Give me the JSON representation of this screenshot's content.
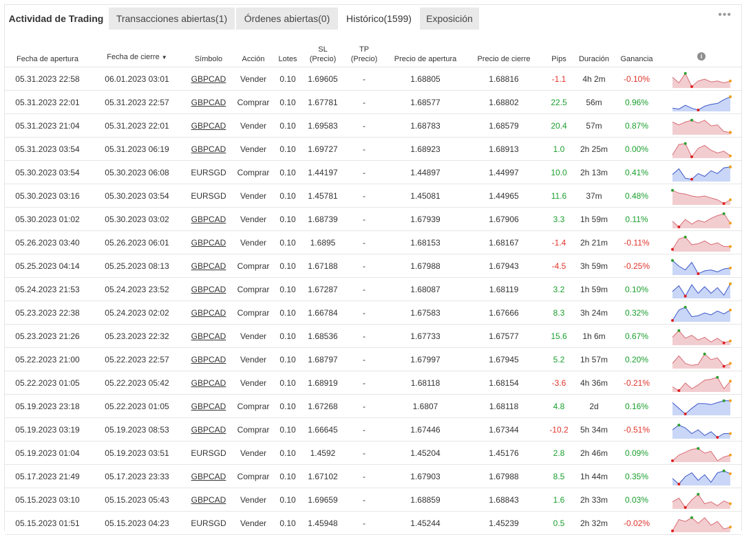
{
  "tabs": {
    "title": "Actividad de Trading",
    "open_transactions": "Transacciones abiertas(1)",
    "open_orders": "Órdenes abiertas(0)",
    "history": "Histórico(1599)",
    "exposure": "Exposición",
    "more": "•••"
  },
  "columns": {
    "open_date": "Fecha de apertura",
    "close_date": "Fecha de cierre",
    "sort_arrow": "▼",
    "symbol": "Símbolo",
    "action": "Acción",
    "lots": "Lotes",
    "sl_1": "SL",
    "sl_2": "(Precio)",
    "tp_1": "TP",
    "tp_2": "(Precio)",
    "open_price": "Precio de apertura",
    "close_price": "Precio de cierre",
    "pips": "Pips",
    "duration": "Duración",
    "profit": "Ganancia",
    "info": "i"
  },
  "colors": {
    "positive": "#1a9e2d",
    "negative": "#e0342b",
    "sell_fill": "#f2cdd0",
    "sell_line": "#d86b73",
    "buy_fill": "#c9d6f7",
    "buy_line": "#3b56c9"
  },
  "rows": [
    {
      "open": "05.31.2023 22:58",
      "close": "06.01.2023 03:01",
      "symbol": "GBPCAD",
      "link": true,
      "action": "Vender",
      "lots": "0.10",
      "sl": "1.69605",
      "tp": "-",
      "open_price": "1.68805",
      "close_price": "1.68816",
      "pips": "-1.1",
      "duration": "4h 2m",
      "profit": "-0.10%",
      "spark": [
        6,
        12,
        2,
        16,
        10,
        8,
        11,
        10,
        12,
        10
      ]
    },
    {
      "open": "05.31.2023 22:01",
      "close": "05.31.2023 22:57",
      "symbol": "GBPCAD",
      "link": true,
      "action": "Comprar",
      "lots": "0.10",
      "sl": "1.67781",
      "tp": "-",
      "open_price": "1.68577",
      "close_price": "1.68802",
      "pips": "22.5",
      "duration": "56m",
      "profit": "0.96%",
      "spark": [
        14,
        15,
        11,
        14,
        16,
        12,
        10,
        9,
        5,
        2
      ]
    },
    {
      "open": "05.31.2023 21:04",
      "close": "05.31.2023 22:01",
      "symbol": "GBPCAD",
      "link": true,
      "action": "Vender",
      "lots": "0.10",
      "sl": "1.69583",
      "tp": "-",
      "open_price": "1.68783",
      "close_price": "1.68579",
      "pips": "20.4",
      "duration": "57m",
      "profit": "0.87%",
      "spark": [
        4,
        7,
        4,
        2,
        5,
        2,
        8,
        7,
        14,
        15
      ]
    },
    {
      "open": "05.31.2023 03:54",
      "close": "05.31.2023 06:19",
      "symbol": "GBPCAD",
      "link": true,
      "action": "Vender",
      "lots": "0.10",
      "sl": "1.69727",
      "tp": "-",
      "open_price": "1.68923",
      "close_price": "1.68913",
      "pips": "1.0",
      "duration": "2h 25m",
      "profit": "0.00%",
      "spark": [
        14,
        3,
        2,
        16,
        7,
        4,
        9,
        12,
        10,
        15
      ]
    },
    {
      "open": "05.30.2023 03:54",
      "close": "05.30.2023 06:08",
      "symbol": "EURSGD",
      "link": false,
      "action": "Comprar",
      "lots": "0.10",
      "sl": "1.44197",
      "tp": "-",
      "open_price": "1.44897",
      "close_price": "1.44997",
      "pips": "10.0",
      "duration": "2h 13m",
      "profit": "0.41%",
      "spark": [
        10,
        4,
        14,
        15,
        9,
        12,
        6,
        9,
        3,
        2
      ]
    },
    {
      "open": "05.30.2023 03:16",
      "close": "05.30.2023 03:54",
      "symbol": "EURSGD",
      "link": false,
      "action": "Vender",
      "lots": "0.10",
      "sl": "1.45781",
      "tp": "-",
      "open_price": "1.45081",
      "close_price": "1.44965",
      "pips": "11.6",
      "duration": "37m",
      "profit": "0.48%",
      "spark": [
        2,
        5,
        6,
        8,
        9,
        8,
        10,
        12,
        16,
        12
      ]
    },
    {
      "open": "05.30.2023 01:02",
      "close": "05.30.2023 03:02",
      "symbol": "GBPCAD",
      "link": true,
      "action": "Vender",
      "lots": "0.10",
      "sl": "1.68739",
      "tp": "-",
      "open_price": "1.67939",
      "close_price": "1.67906",
      "pips": "3.3",
      "duration": "1h 59m",
      "profit": "0.11%",
      "spark": [
        10,
        16,
        8,
        13,
        9,
        11,
        7,
        4,
        2,
        12
      ]
    },
    {
      "open": "05.26.2023 03:40",
      "close": "05.26.2023 06:01",
      "symbol": "GBPCAD",
      "link": true,
      "action": "Vender",
      "lots": "0.10",
      "sl": "1.6895",
      "tp": "-",
      "open_price": "1.68153",
      "close_price": "1.68167",
      "pips": "-1.4",
      "duration": "2h 21m",
      "profit": "-0.11%",
      "spark": [
        15,
        4,
        2,
        10,
        9,
        6,
        10,
        8,
        12,
        12
      ]
    },
    {
      "open": "05.25.2023 04:14",
      "close": "05.25.2023 08:13",
      "symbol": "GBPCAD",
      "link": true,
      "action": "Comprar",
      "lots": "0.10",
      "sl": "1.67188",
      "tp": "-",
      "open_price": "1.67988",
      "close_price": "1.67943",
      "pips": "-4.5",
      "duration": "3h 59m",
      "profit": "-0.25%",
      "spark": [
        2,
        8,
        12,
        4,
        16,
        13,
        12,
        14,
        11,
        10
      ]
    },
    {
      "open": "05.24.2023 21:53",
      "close": "05.24.2023 23:52",
      "symbol": "GBPCAD",
      "link": true,
      "action": "Comprar",
      "lots": "0.10",
      "sl": "1.67287",
      "tp": "-",
      "open_price": "1.68087",
      "close_price": "1.68119",
      "pips": "3.2",
      "duration": "1h 59m",
      "profit": "0.10%",
      "spark": [
        10,
        4,
        15,
        3,
        12,
        5,
        12,
        6,
        14,
        2
      ]
    },
    {
      "open": "05.23.2023 22:38",
      "close": "05.24.2023 02:02",
      "symbol": "GBPCAD",
      "link": true,
      "action": "Comprar",
      "lots": "0.10",
      "sl": "1.66784",
      "tp": "-",
      "open_price": "1.67583",
      "close_price": "1.67666",
      "pips": "8.3",
      "duration": "3h 24m",
      "profit": "0.32%",
      "spark": [
        16,
        5,
        2,
        12,
        11,
        8,
        10,
        6,
        9,
        5
      ]
    },
    {
      "open": "05.23.2023 21:26",
      "close": "05.23.2023 22:32",
      "symbol": "GBPCAD",
      "link": true,
      "action": "Vender",
      "lots": "0.10",
      "sl": "1.68536",
      "tp": "-",
      "open_price": "1.67733",
      "close_price": "1.67577",
      "pips": "15.6",
      "duration": "1h 6m",
      "profit": "0.67%",
      "spark": [
        9,
        2,
        10,
        7,
        12,
        9,
        14,
        10,
        15,
        13
      ]
    },
    {
      "open": "05.22.2023 21:00",
      "close": "05.22.2023 22:57",
      "symbol": "GBPCAD",
      "link": true,
      "action": "Vender",
      "lots": "0.10",
      "sl": "1.68797",
      "tp": "-",
      "open_price": "1.67997",
      "close_price": "1.67945",
      "pips": "5.2",
      "duration": "1h 57m",
      "profit": "0.20%",
      "spark": [
        12,
        4,
        12,
        14,
        13,
        2,
        8,
        6,
        15,
        12
      ]
    },
    {
      "open": "05.22.2023 01:05",
      "close": "05.22.2023 05:42",
      "symbol": "GBPCAD",
      "link": true,
      "action": "Vender",
      "lots": "0.10",
      "sl": "1.68919",
      "tp": "-",
      "open_price": "1.68118",
      "close_price": "1.68154",
      "pips": "-3.6",
      "duration": "4h 36m",
      "profit": "-0.21%",
      "spark": [
        12,
        16,
        8,
        14,
        10,
        5,
        4,
        2,
        14,
        6
      ]
    },
    {
      "open": "05.19.2023 23:18",
      "close": "05.22.2023 01:05",
      "symbol": "GBPCAD",
      "link": true,
      "action": "Comprar",
      "lots": "0.10",
      "sl": "1.67268",
      "tp": "-",
      "open_price": "1.6807",
      "close_price": "1.68118",
      "pips": "4.8",
      "duration": "2d",
      "profit": "0.16%",
      "spark": [
        4,
        10,
        16,
        10,
        5,
        5,
        6,
        4,
        2,
        2
      ]
    },
    {
      "open": "05.19.2023 03:19",
      "close": "05.19.2023 08:53",
      "symbol": "GBPCAD",
      "link": true,
      "action": "Comprar",
      "lots": "0.10",
      "sl": "1.66645",
      "tp": "-",
      "open_price": "1.67446",
      "close_price": "1.67344",
      "pips": "-10.2",
      "duration": "5h 34m",
      "profit": "-0.51%",
      "spark": [
        8,
        3,
        6,
        12,
        8,
        14,
        10,
        16,
        12,
        12
      ]
    },
    {
      "open": "05.19.2023 01:04",
      "close": "05.19.2023 03:51",
      "symbol": "EURSGD",
      "link": false,
      "action": "Vender",
      "lots": "0.10",
      "sl": "1.4592",
      "tp": "-",
      "open_price": "1.45204",
      "close_price": "1.45176",
      "pips": "2.8",
      "duration": "2h 46m",
      "profit": "0.09%",
      "spark": [
        16,
        10,
        7,
        4,
        3,
        8,
        6,
        16,
        12,
        10
      ]
    },
    {
      "open": "05.17.2023 21:49",
      "close": "05.17.2023 23:33",
      "symbol": "GBPCAD",
      "link": true,
      "action": "Comprar",
      "lots": "0.10",
      "sl": "1.67102",
      "tp": "-",
      "open_price": "1.67903",
      "close_price": "1.67988",
      "pips": "8.5",
      "duration": "1h 44m",
      "profit": "0.35%",
      "spark": [
        10,
        16,
        8,
        4,
        12,
        6,
        14,
        4,
        2,
        5
      ]
    },
    {
      "open": "05.15.2023 03:10",
      "close": "05.15.2023 05:43",
      "symbol": "GBPCAD",
      "link": true,
      "action": "Vender",
      "lots": "0.10",
      "sl": "1.69659",
      "tp": "-",
      "open_price": "1.68859",
      "close_price": "1.68843",
      "pips": "1.6",
      "duration": "2h 33m",
      "profit": "0.03%",
      "spark": [
        10,
        6,
        16,
        8,
        2,
        12,
        10,
        14,
        9,
        12
      ]
    },
    {
      "open": "05.15.2023 01:51",
      "close": "05.15.2023 04:23",
      "symbol": "EURSGD",
      "link": false,
      "action": "Vender",
      "lots": "0.10",
      "sl": "1.45948",
      "tp": "-",
      "open_price": "1.45244",
      "close_price": "1.45239",
      "pips": "0.5",
      "duration": "2h 32m",
      "profit": "-0.02%",
      "spark": [
        16,
        4,
        6,
        2,
        8,
        2,
        10,
        6,
        14,
        12
      ]
    }
  ]
}
